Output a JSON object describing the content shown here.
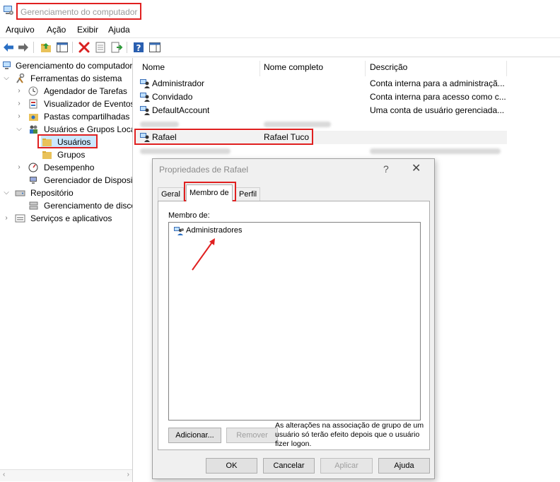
{
  "window": {
    "title": "Gerenciamento do computador"
  },
  "menu": [
    "Arquivo",
    "Ação",
    "Exibir",
    "Ajuda"
  ],
  "toolbar": {
    "icons": [
      "back-arrow-icon",
      "forward-arrow-icon",
      "up-folder-icon",
      "show-hide-tree-icon",
      "delete-icon",
      "properties-icon",
      "export-list-icon",
      "help-icon",
      "action-pane-icon"
    ]
  },
  "tree": {
    "root": "Gerenciamento do computador",
    "system_tools": "Ferramentas do sistema",
    "task_scheduler": "Agendador de Tarefas",
    "event_viewer": "Visualizador de Eventos",
    "shared_folders": "Pastas compartilhadas",
    "local_users_groups": "Usuários e Grupos Loca",
    "users": "Usuários",
    "groups": "Grupos",
    "performance": "Desempenho",
    "device_manager": "Gerenciador de Disposit",
    "storage": "Repositório",
    "disk_management": "Gerenciamento de disco",
    "services_apps": "Serviços e aplicativos"
  },
  "list": {
    "columns": [
      "Nome",
      "Nome completo",
      "Descrição"
    ],
    "rows": [
      {
        "name": "Administrador",
        "full_name": "",
        "description": "Conta interna para a administraçã..."
      },
      {
        "name": "Convidado",
        "full_name": "",
        "description": "Conta interna para acesso como c..."
      },
      {
        "name": "DefaultAccount",
        "full_name": "",
        "description": "Uma conta de usuário gerenciada..."
      },
      {
        "name": "Rafael",
        "full_name": "Rafael Tuco",
        "description": ""
      }
    ]
  },
  "dialog": {
    "title": "Propriedades de Rafael",
    "help": "?",
    "close": "✕",
    "tabs": [
      "Geral",
      "Membro de",
      "Perfil"
    ],
    "member_of_label": "Membro de:",
    "groups": [
      "Administradores"
    ],
    "add_button": "Adicionar...",
    "remove_button": "Remover",
    "note": "As alterações na associação de grupo de um usuário só terão efeito depois que o usuário fizer logon.",
    "ok_button": "OK",
    "cancel_button": "Cancelar",
    "apply_button": "Aplicar",
    "help_button": "Ajuda"
  },
  "colors": {
    "highlight": "#e02020",
    "accent": "#2a6fc4",
    "selection": "#cce8ff"
  }
}
